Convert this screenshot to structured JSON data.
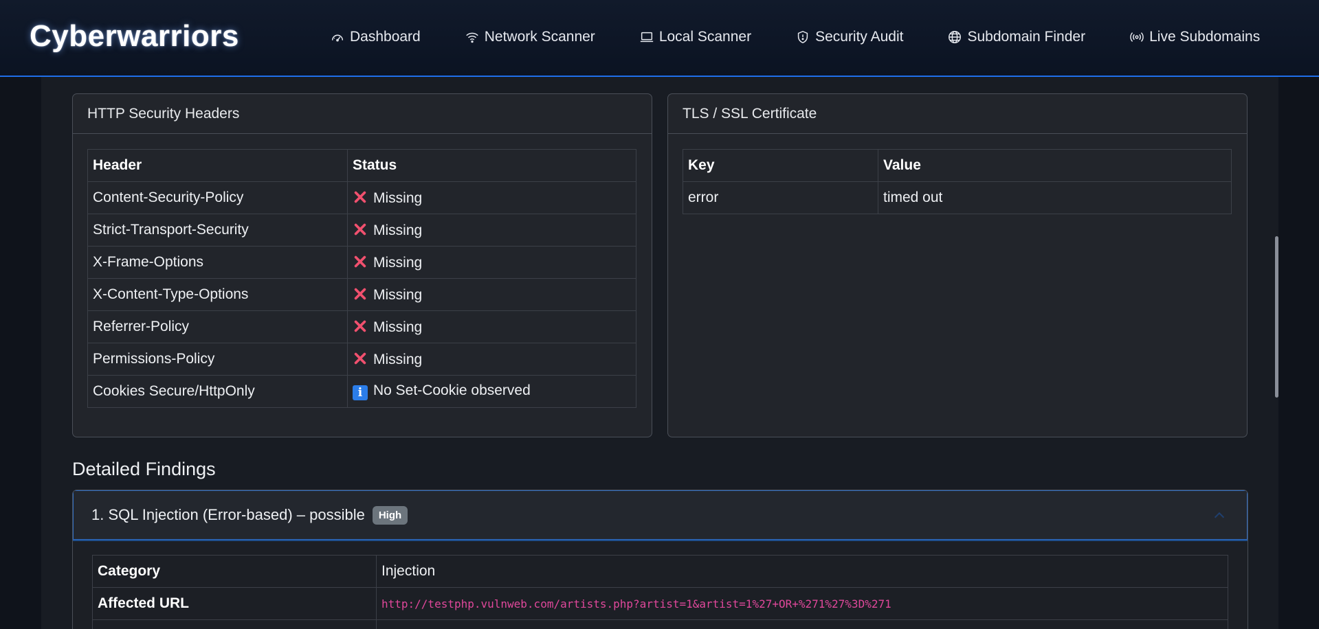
{
  "brand": "Cyberwarriors",
  "nav": [
    {
      "label": "Dashboard",
      "icon": "gauge-icon"
    },
    {
      "label": "Network Scanner",
      "icon": "wifi-icon"
    },
    {
      "label": "Local Scanner",
      "icon": "laptop-icon"
    },
    {
      "label": "Security Audit",
      "icon": "shield-icon"
    },
    {
      "label": "Subdomain Finder",
      "icon": "globe-icon"
    },
    {
      "label": "Live Subdomains",
      "icon": "broadcast-icon"
    }
  ],
  "headers_card": {
    "title": "HTTP Security Headers",
    "col_header": "Header",
    "col_status": "Status",
    "rows": [
      {
        "header": "Content-Security-Policy",
        "status": "Missing",
        "type": "missing"
      },
      {
        "header": "Strict-Transport-Security",
        "status": "Missing",
        "type": "missing"
      },
      {
        "header": "X-Frame-Options",
        "status": "Missing",
        "type": "missing"
      },
      {
        "header": "X-Content-Type-Options",
        "status": "Missing",
        "type": "missing"
      },
      {
        "header": "Referrer-Policy",
        "status": "Missing",
        "type": "missing"
      },
      {
        "header": "Permissions-Policy",
        "status": "Missing",
        "type": "missing"
      },
      {
        "header": "Cookies Secure/HttpOnly",
        "status": "No Set-Cookie observed",
        "type": "info"
      }
    ]
  },
  "tls_card": {
    "title": "TLS / SSL Certificate",
    "col_key": "Key",
    "col_value": "Value",
    "rows": [
      {
        "key": "error",
        "value": "timed out"
      }
    ]
  },
  "findings": {
    "title": "Detailed Findings",
    "items": [
      {
        "heading": "1. SQL Injection (Error-based) – possible",
        "severity": "High",
        "category_label": "Category",
        "category": "Injection",
        "url_label": "Affected URL",
        "url": "http://testphp.vulnweb.com/artists.php?artist=1&artist=1%27+OR+%271%27%3D%271"
      }
    ]
  },
  "colors": {
    "accent": "#1f6feb",
    "missing": "#f0506e",
    "info": "#2b7de9",
    "url": "#e0489b",
    "badge": "#6c757d"
  }
}
